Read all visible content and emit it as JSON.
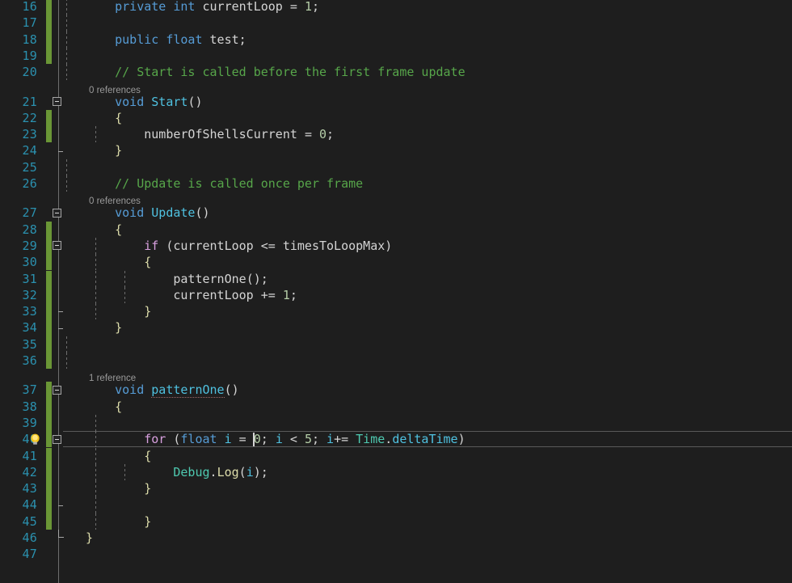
{
  "editor": {
    "name": "code-editor",
    "theme": "visual-studio-dark",
    "language": "csharp",
    "first_visible_line": 16,
    "last_visible_line": 47,
    "line_height_px": 20.3,
    "cursor": {
      "line": 40,
      "column_after_text": "for (float i = 0; i < 5"
    },
    "colors": {
      "background": "#1E1E1E",
      "line_number": "#2B91AF",
      "keyword": "#569CD6",
      "control_keyword": "#D8A0DF",
      "comment": "#57A64A",
      "number": "#B5CEA8",
      "type": "#4EC9B0",
      "method": "#DCDCAA",
      "declared_method": "#4FC1E0",
      "identifier": "#D4D4D4",
      "change_bar_added": "#6A9636",
      "codelens_text": "#9A9A9A",
      "current_line_border": "#5A5A5A"
    }
  },
  "codelens": [
    {
      "above_line": 21,
      "label": "0 references"
    },
    {
      "above_line": 27,
      "label": "0 references"
    },
    {
      "above_line": 37,
      "label": "1 reference"
    }
  ],
  "lines": [
    {
      "n": 16,
      "changed": true,
      "fold": "none",
      "indent_guides": [
        1
      ],
      "tokens": [
        {
          "t": "    ",
          "c": "id"
        },
        {
          "t": "private",
          "c": "kw"
        },
        {
          "t": " ",
          "c": "id"
        },
        {
          "t": "int",
          "c": "kw"
        },
        {
          "t": " currentLoop ",
          "c": "id"
        },
        {
          "t": "=",
          "c": "pun"
        },
        {
          "t": " ",
          "c": "id"
        },
        {
          "t": "1",
          "c": "num"
        },
        {
          "t": ";",
          "c": "pun"
        }
      ]
    },
    {
      "n": 17,
      "changed": true,
      "fold": "none",
      "indent_guides": [
        1
      ],
      "tokens": []
    },
    {
      "n": 18,
      "changed": true,
      "fold": "none",
      "indent_guides": [
        1
      ],
      "tokens": [
        {
          "t": "    ",
          "c": "id"
        },
        {
          "t": "public",
          "c": "kw"
        },
        {
          "t": " ",
          "c": "id"
        },
        {
          "t": "float",
          "c": "kw"
        },
        {
          "t": " test",
          "c": "id"
        },
        {
          "t": ";",
          "c": "pun"
        }
      ]
    },
    {
      "n": 19,
      "changed": true,
      "fold": "none",
      "indent_guides": [
        1
      ],
      "tokens": []
    },
    {
      "n": 20,
      "changed": false,
      "fold": "none",
      "indent_guides": [
        1
      ],
      "tokens": [
        {
          "t": "    ",
          "c": "id"
        },
        {
          "t": "// Start is called before the first frame update",
          "c": "cmt"
        }
      ]
    },
    {
      "n": 21,
      "changed": false,
      "fold": "open",
      "indent_guides": [],
      "tokens": [
        {
          "t": "    ",
          "c": "id"
        },
        {
          "t": "void",
          "c": "kw"
        },
        {
          "t": " ",
          "c": "id"
        },
        {
          "t": "Start",
          "c": "fn"
        },
        {
          "t": "()",
          "c": "pun"
        }
      ]
    },
    {
      "n": 22,
      "changed": true,
      "fold": "none",
      "indent_guides": [],
      "tokens": [
        {
          "t": "    ",
          "c": "id"
        },
        {
          "t": "{",
          "c": "brc"
        }
      ]
    },
    {
      "n": 23,
      "changed": true,
      "fold": "none",
      "indent_guides": [
        2
      ],
      "tokens": [
        {
          "t": "        numberOfShellsCurrent ",
          "c": "id"
        },
        {
          "t": "=",
          "c": "pun"
        },
        {
          "t": " ",
          "c": "id"
        },
        {
          "t": "0",
          "c": "num"
        },
        {
          "t": ";",
          "c": "pun"
        }
      ]
    },
    {
      "n": 24,
      "changed": false,
      "fold": "close",
      "indent_guides": [],
      "tokens": [
        {
          "t": "    ",
          "c": "id"
        },
        {
          "t": "}",
          "c": "brc"
        }
      ]
    },
    {
      "n": 25,
      "changed": false,
      "fold": "none",
      "indent_guides": [
        1
      ],
      "tokens": []
    },
    {
      "n": 26,
      "changed": false,
      "fold": "none",
      "indent_guides": [
        1
      ],
      "tokens": [
        {
          "t": "    ",
          "c": "id"
        },
        {
          "t": "// Update is called once per frame",
          "c": "cmt"
        }
      ]
    },
    {
      "n": 27,
      "changed": false,
      "fold": "open",
      "indent_guides": [],
      "tokens": [
        {
          "t": "    ",
          "c": "id"
        },
        {
          "t": "void",
          "c": "kw"
        },
        {
          "t": " ",
          "c": "id"
        },
        {
          "t": "Update",
          "c": "fn"
        },
        {
          "t": "()",
          "c": "pun"
        }
      ]
    },
    {
      "n": 28,
      "changed": true,
      "fold": "none",
      "indent_guides": [],
      "tokens": [
        {
          "t": "    ",
          "c": "id"
        },
        {
          "t": "{",
          "c": "brc"
        }
      ]
    },
    {
      "n": 29,
      "changed": true,
      "fold": "open",
      "indent_guides": [
        2
      ],
      "tokens": [
        {
          "t": "        ",
          "c": "id"
        },
        {
          "t": "if",
          "c": "ctl"
        },
        {
          "t": " (currentLoop ",
          "c": "id"
        },
        {
          "t": "<=",
          "c": "pun"
        },
        {
          "t": " timesToLoopMax)",
          "c": "id"
        }
      ]
    },
    {
      "n": 30,
      "changed": true,
      "fold": "none",
      "indent_guides": [
        2
      ],
      "tokens": [
        {
          "t": "        ",
          "c": "id"
        },
        {
          "t": "{",
          "c": "brc"
        }
      ]
    },
    {
      "n": 31,
      "changed": true,
      "fold": "none",
      "indent_guides": [
        2,
        3
      ],
      "tokens": [
        {
          "t": "            patternOne",
          "c": "id"
        },
        {
          "t": "();",
          "c": "pun"
        }
      ]
    },
    {
      "n": 32,
      "changed": true,
      "fold": "none",
      "indent_guides": [
        2,
        3
      ],
      "tokens": [
        {
          "t": "            currentLoop ",
          "c": "id"
        },
        {
          "t": "+=",
          "c": "pun"
        },
        {
          "t": " ",
          "c": "id"
        },
        {
          "t": "1",
          "c": "num"
        },
        {
          "t": ";",
          "c": "pun"
        }
      ]
    },
    {
      "n": 33,
      "changed": true,
      "fold": "close2",
      "indent_guides": [
        2
      ],
      "tokens": [
        {
          "t": "        ",
          "c": "id"
        },
        {
          "t": "}",
          "c": "brc"
        }
      ]
    },
    {
      "n": 34,
      "changed": true,
      "fold": "close",
      "indent_guides": [],
      "tokens": [
        {
          "t": "    ",
          "c": "id"
        },
        {
          "t": "}",
          "c": "brc"
        }
      ]
    },
    {
      "n": 35,
      "changed": true,
      "fold": "none",
      "indent_guides": [
        1
      ],
      "tokens": []
    },
    {
      "n": 36,
      "changed": true,
      "fold": "none",
      "indent_guides": [
        1
      ],
      "tokens": []
    },
    {
      "n": 37,
      "changed": true,
      "fold": "open",
      "indent_guides": [],
      "tokens": [
        {
          "t": "    ",
          "c": "id"
        },
        {
          "t": "void",
          "c": "kw"
        },
        {
          "t": " ",
          "c": "id"
        },
        {
          "t": "patternOne",
          "c": "fn squiggle"
        },
        {
          "t": "()",
          "c": "pun"
        }
      ]
    },
    {
      "n": 38,
      "changed": true,
      "fold": "none",
      "indent_guides": [],
      "tokens": [
        {
          "t": "    ",
          "c": "id"
        },
        {
          "t": "{",
          "c": "brc"
        }
      ]
    },
    {
      "n": 39,
      "changed": true,
      "fold": "none",
      "indent_guides": [
        2
      ],
      "tokens": []
    },
    {
      "n": 40,
      "changed": true,
      "fold": "open",
      "indent_guides": [
        2
      ],
      "current": true,
      "bulb": true,
      "tokens": [
        {
          "t": "        ",
          "c": "id"
        },
        {
          "t": "for",
          "c": "ctl"
        },
        {
          "t": " (",
          "c": "pun"
        },
        {
          "t": "float",
          "c": "kw"
        },
        {
          "t": " ",
          "c": "id"
        },
        {
          "t": "i",
          "c": "fn"
        },
        {
          "t": " = ",
          "c": "pun"
        },
        {
          "t": "0",
          "c": "num"
        },
        {
          "t": "; ",
          "c": "pun"
        },
        {
          "t": "i",
          "c": "fn"
        },
        {
          "t": " < ",
          "c": "pun"
        },
        {
          "t": "5",
          "c": "num"
        },
        {
          "t": "; ",
          "c": "pun"
        },
        {
          "t": "i",
          "c": "fn"
        },
        {
          "t": "+= ",
          "c": "pun"
        },
        {
          "t": "Time",
          "c": "typ"
        },
        {
          "t": ".",
          "c": "pun"
        },
        {
          "t": "deltaTime",
          "c": "fn"
        },
        {
          "t": ")",
          "c": "pun"
        }
      ]
    },
    {
      "n": 41,
      "changed": true,
      "fold": "none",
      "indent_guides": [
        2
      ],
      "tokens": [
        {
          "t": "        ",
          "c": "id"
        },
        {
          "t": "{",
          "c": "brc"
        }
      ]
    },
    {
      "n": 42,
      "changed": true,
      "fold": "none",
      "indent_guides": [
        2,
        3
      ],
      "tokens": [
        {
          "t": "            ",
          "c": "id"
        },
        {
          "t": "Debug",
          "c": "typ"
        },
        {
          "t": ".",
          "c": "pun"
        },
        {
          "t": "Log",
          "c": "mth"
        },
        {
          "t": "(",
          "c": "pun"
        },
        {
          "t": "i",
          "c": "fn"
        },
        {
          "t": ");",
          "c": "pun"
        }
      ]
    },
    {
      "n": 43,
      "changed": true,
      "fold": "none",
      "indent_guides": [
        2
      ],
      "tokens": [
        {
          "t": "        ",
          "c": "id"
        },
        {
          "t": "}",
          "c": "brc"
        }
      ]
    },
    {
      "n": 44,
      "changed": true,
      "fold": "close2",
      "indent_guides": [
        2
      ],
      "tokens": []
    },
    {
      "n": 45,
      "changed": true,
      "fold": "none",
      "indent_guides": [
        2
      ],
      "tokens": [
        {
          "t": "        ",
          "c": "id"
        },
        {
          "t": "}",
          "c": "brc"
        }
      ]
    },
    {
      "n": 46,
      "changed": false,
      "fold": "closeAll",
      "indent_guides": [],
      "tokens": [
        {
          "t": "}",
          "c": "brc"
        }
      ]
    },
    {
      "n": 47,
      "changed": false,
      "fold": "none",
      "indent_guides": [],
      "tokens": []
    }
  ]
}
